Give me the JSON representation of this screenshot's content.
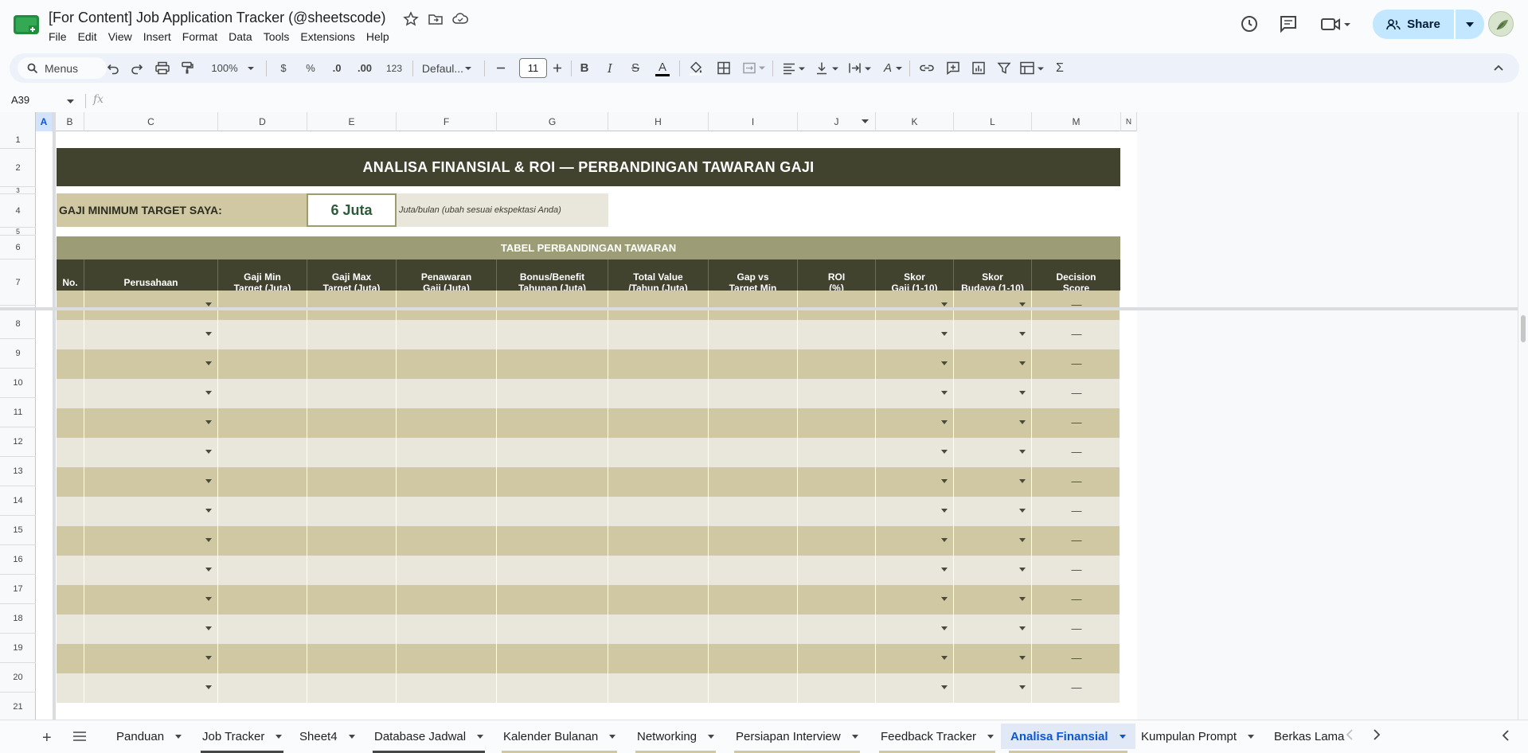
{
  "title_bar": {
    "doc_title": "[For Content] Job Application Tracker (@sheetscode)",
    "share_label": "Share"
  },
  "menu": [
    "File",
    "Edit",
    "View",
    "Insert",
    "Format",
    "Data",
    "Tools",
    "Extensions",
    "Help"
  ],
  "toolbar": {
    "search_label": "Menus",
    "zoom": "100%",
    "currency": "$",
    "percent": "%",
    "decrease_decimal": ".0",
    "increase_decimal": ".00",
    "number_format": "123",
    "font": "Defaul...",
    "font_size": "11",
    "bold": "B",
    "italic": "I",
    "strike": "S",
    "text_color": "A",
    "text_rotation": "A",
    "functions": "Σ"
  },
  "formula_bar": {
    "cell_ref": "A39",
    "fx": "fx"
  },
  "columns": [
    "A",
    "B",
    "C",
    "D",
    "E",
    "F",
    "G",
    "H",
    "I",
    "J",
    "K",
    "L",
    "M",
    "N"
  ],
  "rows": [
    "1",
    "2",
    "3",
    "4",
    "5",
    "6",
    "7",
    "8",
    "9",
    "10",
    "11",
    "12",
    "13",
    "14",
    "15",
    "16",
    "17",
    "18",
    "19",
    "20",
    "21"
  ],
  "sheet": {
    "main_title": "ANALISA FINANSIAL & ROI — PERBANDINGAN TAWARAN GAJI",
    "target_label": "GAJI MINIMUM TARGET SAYA:",
    "target_value": "6 Juta",
    "target_note": "Juta/bulan (ubah sesuai ekspektasi Anda)",
    "table_title": "TABEL PERBANDINGAN TAWARAN",
    "headers": [
      "No.",
      "Perusahaan",
      "Gaji Min\nTarget (Juta)",
      "Gaji Max\nTarget (Juta)",
      "Penawaran\nGaji (Juta)",
      "Bonus/Benefit\nTahunan (Juta)",
      "Total Value\n/Tahun (Juta)",
      "Gap vs\nTarget Min",
      "ROI\n(%)",
      "Skor\nGaji (1-10)",
      "Skor\nBudaya (1-10)",
      "Decision\nScore"
    ],
    "empty_score": "—"
  },
  "tabs": [
    {
      "label": "Panduan",
      "color": ""
    },
    {
      "label": "Job Tracker",
      "color": "#444746"
    },
    {
      "label": "Sheet4",
      "color": ""
    },
    {
      "label": "Database Jadwal",
      "color": "#444746"
    },
    {
      "label": "Kalender Bulanan",
      "color": "#cfc8a3"
    },
    {
      "label": "Networking",
      "color": "#cfc8a3"
    },
    {
      "label": "Persiapan Interview",
      "color": "#cfc8a3"
    },
    {
      "label": "Feedback Tracker",
      "color": "#cfc8a3"
    },
    {
      "label": "Analisa Finansial",
      "color": "#cfc8a3"
    },
    {
      "label": "Kumpulan Prompt",
      "color": ""
    },
    {
      "label": "Berkas Lama",
      "color": "#cfc8a3"
    }
  ],
  "colors": {
    "dark_olive": "#42432f",
    "sage": "#9c9d76",
    "khaki": "#cfc8a3",
    "light_khaki": "#e9e7dc",
    "accent_blue": "#0b57d0"
  }
}
